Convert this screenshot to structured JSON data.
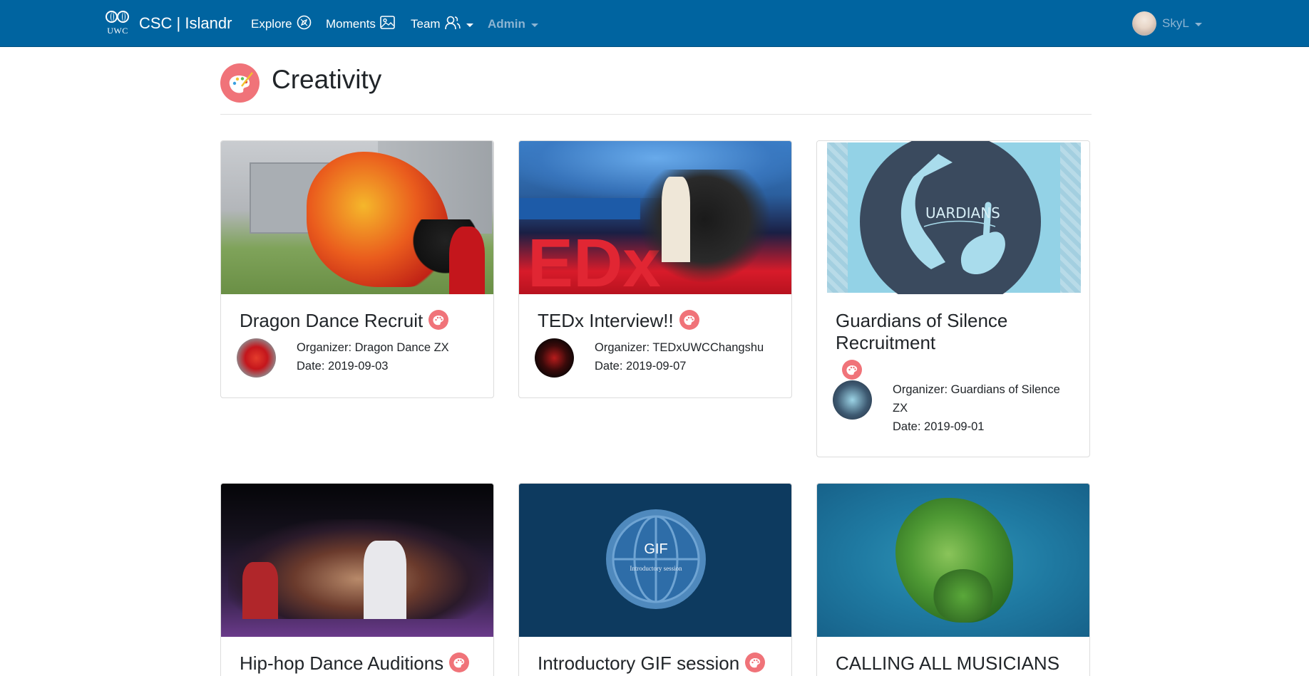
{
  "navbar": {
    "brand_logo_text": "UWC",
    "brand_text": "CSC | Islandr",
    "items": [
      {
        "label": "Explore",
        "icon": "compass-icon"
      },
      {
        "label": "Moments",
        "icon": "image-icon"
      },
      {
        "label": "Team",
        "icon": "users-icon"
      },
      {
        "label": "Admin"
      }
    ],
    "user": {
      "name": "SkyL"
    }
  },
  "category": {
    "title": "Creativity",
    "icon": "palette-icon",
    "accent": "#f07379"
  },
  "events": [
    {
      "title": "Dragon Dance Recruit",
      "organizer": "Organizer: Dragon Dance ZX",
      "date": "Date: 2019-09-03"
    },
    {
      "title": "TEDx Interview!!",
      "organizer": "Organizer: TEDxUWCChangshu",
      "date": "Date: 2019-09-07"
    },
    {
      "title": "Guardians of Silence Recruitment",
      "organizer": "Organizer: Guardians of Silence ZX",
      "date": "Date: 2019-09-01",
      "image_text": "UARDIANS"
    },
    {
      "title": "Hip-hop Dance Auditions"
    },
    {
      "title": "Introductory GIF session",
      "image_text_main": "GIF",
      "image_text_sub": "Introductory session"
    },
    {
      "title": "CALLING ALL MUSICIANS"
    }
  ],
  "colors": {
    "navbar": "#0064a0",
    "accent": "#f07379",
    "muted_nav": "#8cb4d2"
  }
}
